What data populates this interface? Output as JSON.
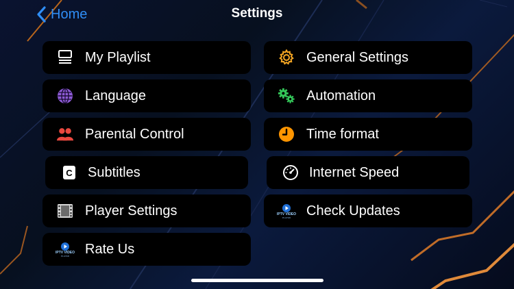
{
  "header": {
    "back_label": "Home",
    "title": "Settings"
  },
  "menu": {
    "left": [
      {
        "label": "My Playlist",
        "icon": "playlist-icon"
      },
      {
        "label": "Language",
        "icon": "globe-icon"
      },
      {
        "label": "Parental Control",
        "icon": "users-icon"
      },
      {
        "label": "Subtitles",
        "icon": "subtitles-icon"
      },
      {
        "label": "Player Settings",
        "icon": "film-icon"
      },
      {
        "label": "Rate Us",
        "icon": "app-logo-icon"
      }
    ],
    "right": [
      {
        "label": "General Settings",
        "icon": "gear-icon"
      },
      {
        "label": "Automation",
        "icon": "gears-icon"
      },
      {
        "label": "Time format",
        "icon": "clock-icon"
      },
      {
        "label": "Internet Speed",
        "icon": "speedometer-icon"
      },
      {
        "label": "Check Updates",
        "icon": "app-logo-icon"
      }
    ]
  },
  "logo_text": "IPTV VIDEO",
  "logo_subtext": "PLAYER",
  "colors": {
    "accent": "#2f8df5",
    "background": "#0a1330",
    "card": "#000000",
    "gear": "#f5a623",
    "globe": "#8e5bd6",
    "users": "#e8483f",
    "automation": "#34c759",
    "clock": "#ff9500"
  }
}
